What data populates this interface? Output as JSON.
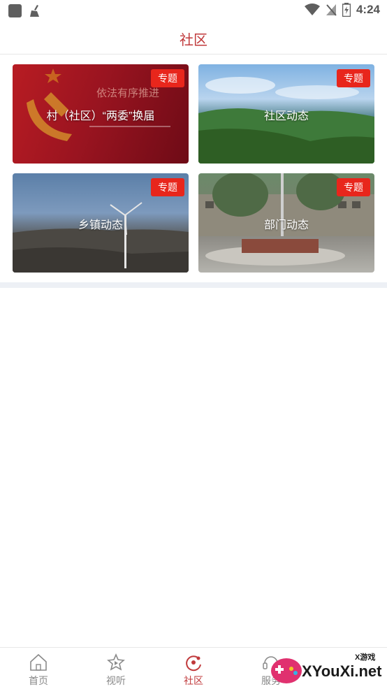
{
  "status_bar": {
    "time": "4:24"
  },
  "header": {
    "title": "社区"
  },
  "cards": [
    {
      "label": "村（社区）“两委”换届",
      "badge": "专题",
      "overlay_text": "依法有序推进"
    },
    {
      "label": "社区动态",
      "badge": "专题"
    },
    {
      "label": "乡镇动态",
      "badge": "专题"
    },
    {
      "label": "部门动态",
      "badge": "专题"
    }
  ],
  "bottom_nav": {
    "items": [
      {
        "label": "首页",
        "icon": "home-icon",
        "active": false
      },
      {
        "label": "视听",
        "icon": "play-star-icon",
        "active": false
      },
      {
        "label": "社区",
        "icon": "community-icon",
        "active": true
      },
      {
        "label": "服务",
        "icon": "service-icon",
        "active": false
      }
    ]
  },
  "watermark": {
    "text": "XYouXi.net",
    "small": "X游戏"
  },
  "colors": {
    "accent": "#c0393b",
    "badge": "#e8261c",
    "band": "#edf0f5"
  }
}
